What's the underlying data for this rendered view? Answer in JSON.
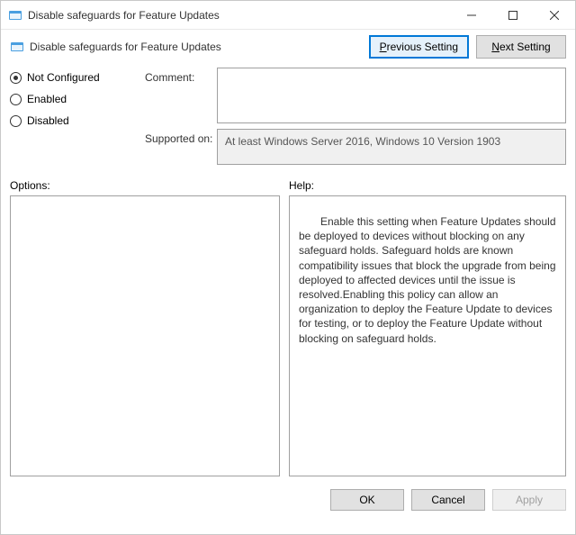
{
  "window": {
    "title": "Disable safeguards for Feature Updates"
  },
  "header": {
    "setting_name": "Disable safeguards for Feature Updates",
    "previous_accel": "P",
    "previous_rest": "revious Setting",
    "next_accel": "N",
    "next_rest": "ext Setting"
  },
  "state": {
    "not_configured": "Not Configured",
    "enabled": "Enabled",
    "disabled": "Disabled",
    "selected": "not_configured"
  },
  "fields": {
    "comment_label": "Comment:",
    "comment_value": "",
    "supported_label": "Supported on:",
    "supported_value": "At least Windows Server 2016, Windows 10 Version 1903"
  },
  "panes": {
    "options_label": "Options:",
    "help_label": "Help:",
    "help_text": "Enable this setting when Feature Updates should be deployed to devices without blocking on any safeguard holds. Safeguard holds are known compatibility issues that block the upgrade from being deployed to affected devices until the issue is resolved.Enabling this policy can allow an organization to deploy the Feature Update to devices for testing, or to deploy the Feature Update without blocking on safeguard holds."
  },
  "footer": {
    "ok": "OK",
    "cancel": "Cancel",
    "apply": "Apply"
  }
}
